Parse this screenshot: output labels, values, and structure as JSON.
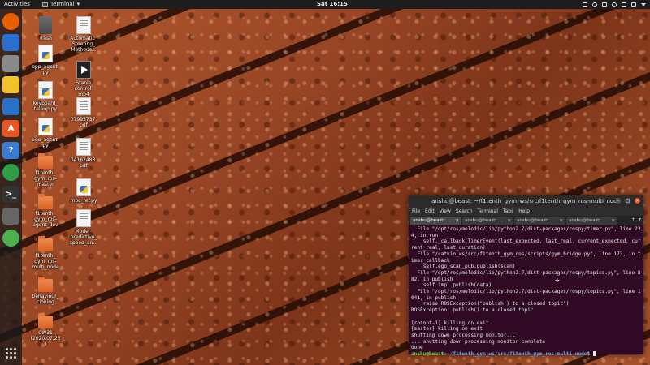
{
  "topbar": {
    "activities": "Activities",
    "app_menu": "Terminal",
    "clock": "Sat 16:15"
  },
  "dock": {
    "items": [
      {
        "name": "firefox-icon",
        "color": "#e66000"
      },
      {
        "name": "thunderbird-icon",
        "color": "#2a6ed1"
      },
      {
        "name": "files-icon",
        "color": "#8a8a8a"
      },
      {
        "name": "rhythmbox-icon",
        "color": "#f3c12a"
      },
      {
        "name": "libreoffice-writer-icon",
        "color": "#2a72c8"
      },
      {
        "name": "software-center-icon",
        "color": "#e95420"
      },
      {
        "name": "help-icon",
        "color": "#3b7bd4"
      },
      {
        "name": "chrome-icon",
        "color": "#2e9e47"
      },
      {
        "name": "terminal-icon",
        "color": "#333333"
      },
      {
        "name": "screenshot-icon",
        "color": "#666666"
      },
      {
        "name": "network-icon",
        "color": "#4caf50"
      }
    ],
    "glyphs": [
      "",
      "",
      "",
      "",
      "",
      "A",
      "?",
      "",
      ">_",
      "",
      ""
    ]
  },
  "desktop_icons": [
    {
      "label": "Trash",
      "type": "trash"
    },
    {
      "label": "opp_agent.\npy",
      "type": "py"
    },
    {
      "label": "keyboard_\nteleop.py",
      "type": "py"
    },
    {
      "label": "ego_agent.\npy",
      "type": "py"
    },
    {
      "label": "f1tenth_\ngym_ros-\nmaster",
      "type": "folder"
    },
    {
      "label": "f1tenth_\ngym_ros-\nagent_dev",
      "type": "folder"
    },
    {
      "label": "f1tenth_\ngym_ros-\nmulti_node",
      "type": "folder"
    },
    {
      "label": "behaviour_\ncloning",
      "type": "folder"
    },
    {
      "label": "CW31\n(2020.07.25\n)",
      "type": "folder"
    },
    {
      "label": "Automatic_\nSteering_\nMethods...",
      "type": "doc"
    },
    {
      "label": "Stanle\ncontrol.\nmp4",
      "type": "video"
    },
    {
      "label": "07995737.\npdf",
      "type": "doc"
    },
    {
      "label": "04162483.\npdf",
      "type": "doc"
    },
    {
      "label": "mpc_ref.py",
      "type": "py"
    },
    {
      "label": "Model_\npredictive_\nspeed_an...",
      "type": "doc"
    }
  ],
  "terminal": {
    "title": "anshu@beast: ~/f1tenth_gym_ws/src/f1tenth_gym_ros-multi_node",
    "menu": [
      "File",
      "Edit",
      "View",
      "Search",
      "Terminal",
      "Tabs",
      "Help"
    ],
    "tabs": [
      "anshu@beast: ...",
      "anshu@beast: ...",
      "anshu@beast: ...",
      "anshu@beast: ..."
    ],
    "tab_close": "×",
    "lines": [
      "  File \"/opt/ros/melodic/lib/python2.7/dist-packages/rospy/timer.py\", line 234, in run",
      "    self._callback(TimerEvent(last_expected, last_real, current_expected, current_real, last_duration))",
      "  File \"/catkin_ws/src/f1tenth_gym_ros/scripts/gym_bridge.py\", line 173, in timer_callback",
      "    self.ego_scan_pub.publish(scan)",
      "  File \"/opt/ros/melodic/lib/python2.7/dist-packages/rospy/topics.py\", line 882, in publish",
      "    self.impl.publish(data)",
      "  File \"/opt/ros/melodic/lib/python2.7/dist-packages/rospy/topics.py\", line 1041, in publish",
      "    raise ROSException(\"publish() to a closed topic\")",
      "ROSException: publish() to a closed topic",
      "",
      "[rosout-1] killing on exit",
      "[master] killing on exit",
      "shutting down processing monitor...",
      "... shutting down processing monitor complete",
      "done"
    ],
    "prompt_user": "anshu@beast",
    "prompt_path": ":~/f1tenth_gym_ws/src/f1tenth_gym_ros-multi_node",
    "prompt_symbol": "$ "
  }
}
